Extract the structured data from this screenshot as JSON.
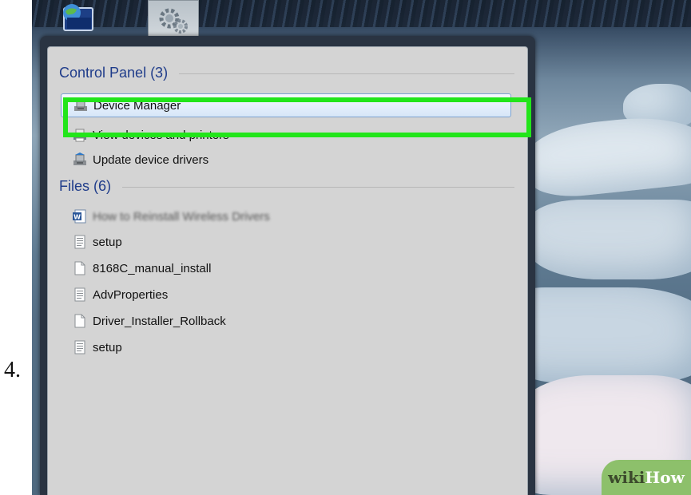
{
  "step": {
    "number": "4."
  },
  "taskbar": {
    "icons": [
      "globe-icon",
      "gear-icon"
    ]
  },
  "search_results": {
    "control_panel": {
      "header": "Control Panel (3)",
      "items": [
        {
          "label": "Device Manager",
          "icon": "device-manager-icon",
          "highlighted": true
        },
        {
          "label": "View devices and printers",
          "icon": "printer-icon"
        },
        {
          "label": "Update device drivers",
          "icon": "device-manager-icon"
        }
      ]
    },
    "files": {
      "header": "Files (6)",
      "items": [
        {
          "label": "How to Reinstall Wireless Drivers",
          "icon": "word-document-icon",
          "blurred": true
        },
        {
          "label": "setup",
          "icon": "text-file-icon"
        },
        {
          "label": "8168C_manual_install",
          "icon": "blank-file-icon"
        },
        {
          "label": "AdvProperties",
          "icon": "text-file-icon"
        },
        {
          "label": "Driver_Installer_Rollback",
          "icon": "blank-file-icon"
        },
        {
          "label": "setup",
          "icon": "text-file-icon"
        }
      ]
    }
  },
  "watermark": {
    "wiki": "wiki",
    "how": "How"
  },
  "colors": {
    "highlight_border": "#22e51a",
    "section_header": "#1f3c8a",
    "pane_background": "#d4d4d4",
    "selection_border": "#7da2ce"
  }
}
